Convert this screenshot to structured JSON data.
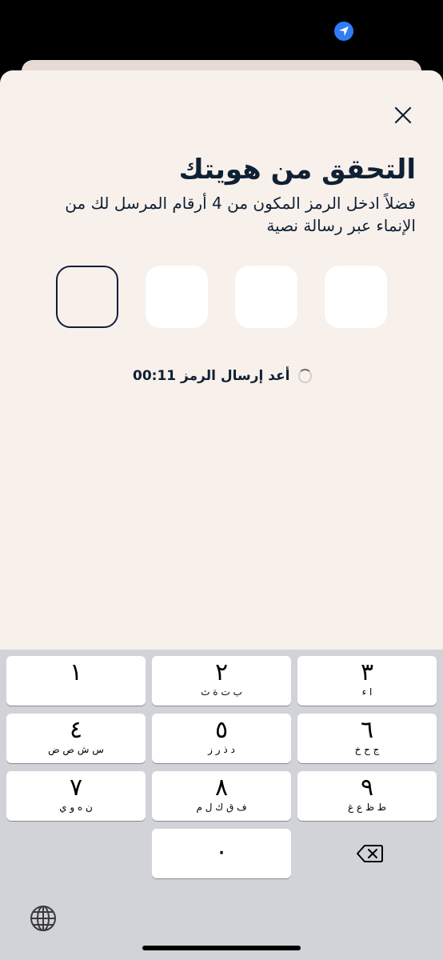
{
  "status_bar": {
    "location_icon": "location-arrow-icon"
  },
  "sheet": {
    "close_icon": "close-icon",
    "title": "التحقق من هويتك",
    "subtitle": "فضلاً ادخل الرمز المكون من 4 أرقام المرسل لك من الإنماء عبر رسالة نصية",
    "otp": {
      "length": 4,
      "values": [
        "",
        "",
        "",
        ""
      ]
    },
    "resend": {
      "label": "أعد إرسال الرمز",
      "timer": "00:11"
    }
  },
  "keyboard": {
    "keys": [
      {
        "digit": "١",
        "letters": ""
      },
      {
        "digit": "٢",
        "letters": "ب ت ة ث"
      },
      {
        "digit": "٣",
        "letters": "ا ء"
      },
      {
        "digit": "٤",
        "letters": "س ش ص ض"
      },
      {
        "digit": "٥",
        "letters": "د ذ ر ز"
      },
      {
        "digit": "٦",
        "letters": "ج ح خ"
      },
      {
        "digit": "٧",
        "letters": "ن ه و ي"
      },
      {
        "digit": "٨",
        "letters": "ف ق ك ل م"
      },
      {
        "digit": "٩",
        "letters": "ط ظ ع غ"
      },
      {
        "digit": "٠",
        "letters": ""
      }
    ],
    "backspace_icon": "backspace-icon",
    "globe_icon": "globe-icon"
  }
}
